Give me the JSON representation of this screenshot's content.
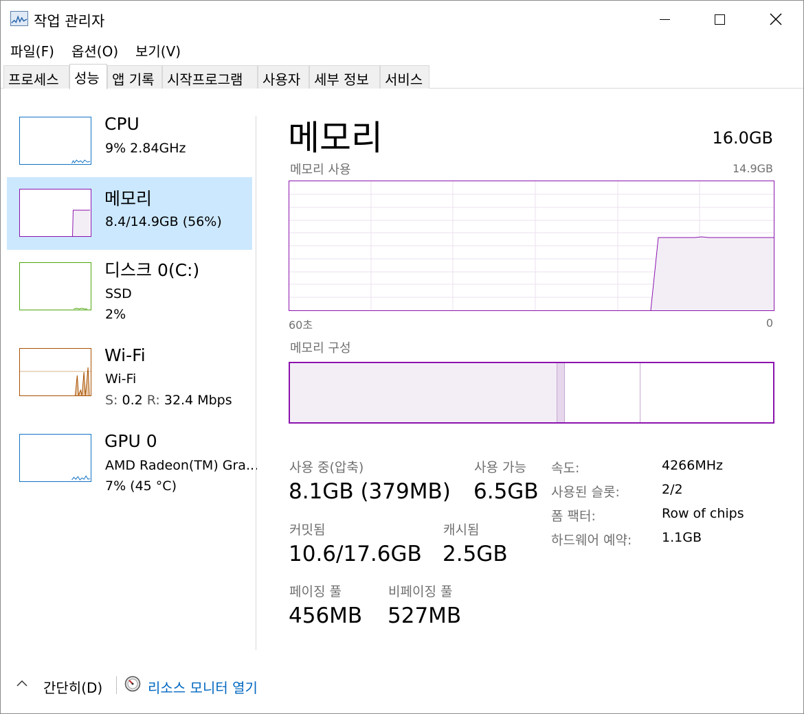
{
  "window": {
    "title": "작업 관리자",
    "icon": "task-manager-icon"
  },
  "menu": [
    {
      "label": "파일(F)"
    },
    {
      "label": "옵션(O)"
    },
    {
      "label": "보기(V)"
    }
  ],
  "tabs": [
    {
      "label": "프로세스"
    },
    {
      "label": "성능",
      "active": true
    },
    {
      "label": "앱 기록"
    },
    {
      "label": "시작프로그램"
    },
    {
      "label": "사용자"
    },
    {
      "label": "세부 정보"
    },
    {
      "label": "서비스"
    }
  ],
  "sidebar": {
    "items": [
      {
        "title": "CPU",
        "line1": "9% 2.84GHz",
        "color": "#1172c3"
      },
      {
        "title": "메모리",
        "line1": "8.4/14.9GB (56%)",
        "color": "#8b12ae",
        "selected": true
      },
      {
        "title": "디스크 0(C:)",
        "line1": "SSD",
        "line2": "2%",
        "color": "#4da60c"
      },
      {
        "title": "Wi-Fi",
        "line1": "Wi-Fi",
        "send_label": "S:",
        "send_value": "0.2",
        "recv_label": "R:",
        "recv_value": "32.4 Mbps",
        "color": "#a74f01"
      },
      {
        "title": "GPU 0",
        "line1": "AMD Radeon(TM) Gra...",
        "line2": "7% (45 °C)",
        "color": "#1172c3"
      }
    ]
  },
  "main": {
    "title": "메모리",
    "total": "16.0GB",
    "usage_graph_label": "메모리 사용",
    "usage_graph_max": "14.9GB",
    "axis_left": "60초",
    "axis_right": "0",
    "usage_level": 0.56,
    "composition_label": "메모리 구성",
    "accent_color": "#8b12ae"
  },
  "stats": {
    "in_use_label": "사용 중(압축)",
    "in_use_value": "8.1GB (379MB)",
    "available_label": "사용 가능",
    "available_value": "6.5GB",
    "committed_label": "커밋됨",
    "committed_value": "10.6/17.6GB",
    "cached_label": "캐시됨",
    "cached_value": "2.5GB",
    "paged_label": "페이징 풀",
    "paged_value": "456MB",
    "nonpaged_label": "비페이징 풀",
    "nonpaged_value": "527MB"
  },
  "properties": {
    "speed_label": "속도:",
    "speed_value": "4266MHz",
    "slots_label": "사용된 슬롯:",
    "slots_value": "2/2",
    "form_label": "폼 팩터:",
    "form_value": "Row of chips",
    "reserved_label": "하드웨어 예약:",
    "reserved_value": "1.1GB"
  },
  "footer": {
    "collapse_label": "간단히(D)",
    "monitor_label": "리소스 모니터 열기"
  }
}
